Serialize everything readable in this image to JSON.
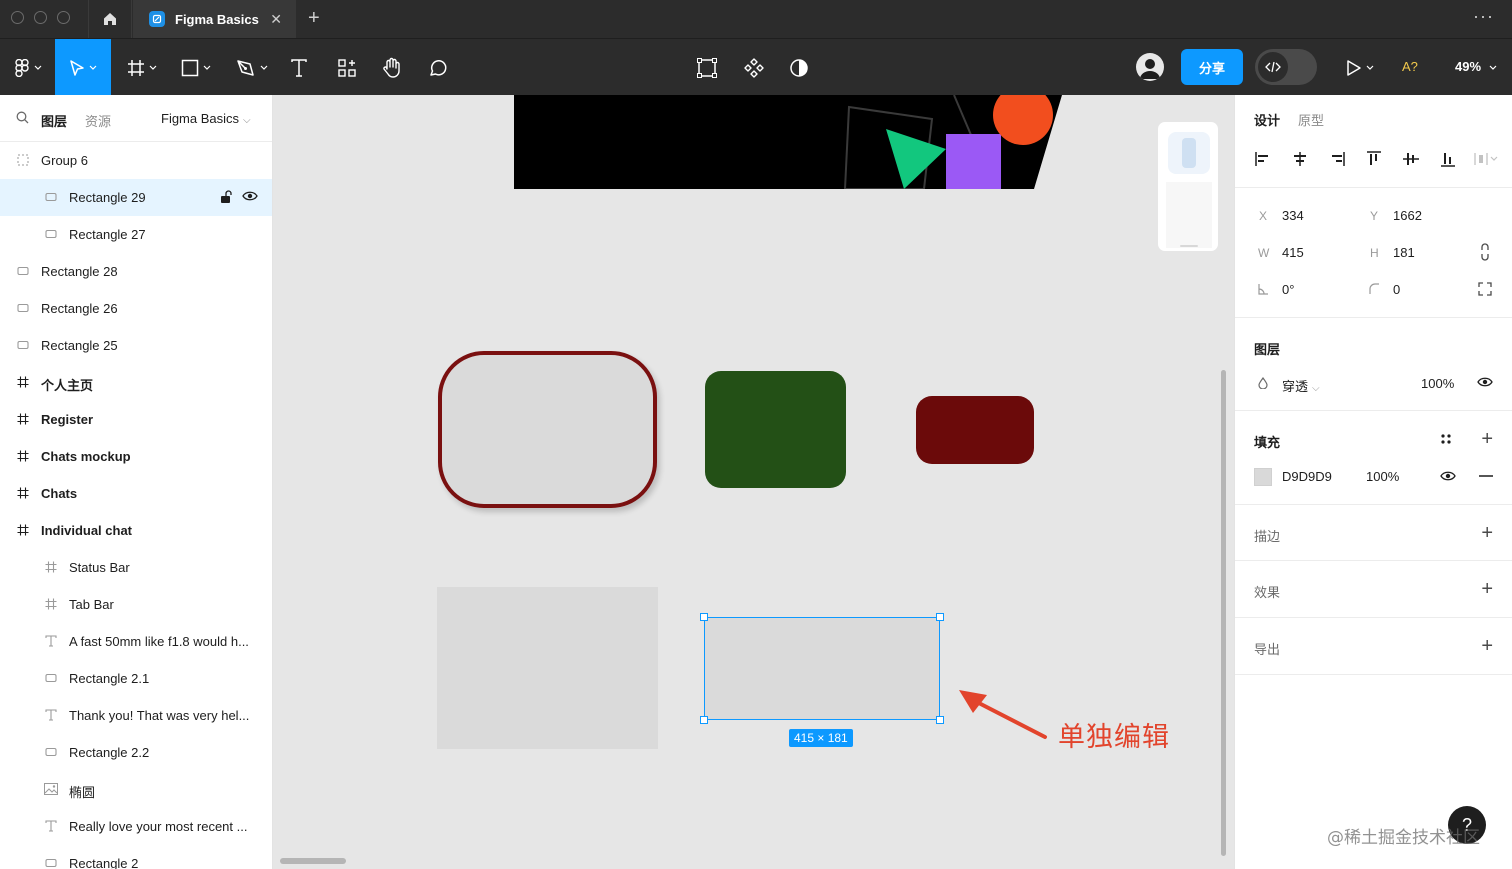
{
  "titlebar": {
    "file_tab": "Figma Basics",
    "new_tab_glyph": "+",
    "more_glyph": "···",
    "close_glyph": "✕"
  },
  "toolbar": {
    "share_label": "分享",
    "font_warning": "A?",
    "zoom_label": "49%",
    "tools": [
      "figma-menu-icon",
      "move-tool-icon",
      "frame-tool-icon",
      "rectangle-tool-icon",
      "pen-tool-icon",
      "text-tool-icon",
      "resources-icon",
      "hand-tool-icon",
      "comment-icon",
      "edit-object-icon",
      "component-icon",
      "mask-icon",
      "play-icon"
    ]
  },
  "left_panel": {
    "tab_layers": "图层",
    "tab_assets": "资源",
    "page_name": "Figma Basics",
    "layers": [
      {
        "label": "Group 6",
        "icon": "group-icon",
        "indent": 0,
        "bold": false,
        "selected": false
      },
      {
        "label": "Rectangle 29",
        "icon": "rectangle-icon",
        "indent": 1,
        "bold": false,
        "selected": true
      },
      {
        "label": "Rectangle 27",
        "icon": "rectangle-icon",
        "indent": 1,
        "bold": false,
        "selected": false
      },
      {
        "label": "Rectangle 28",
        "icon": "rectangle-icon",
        "indent": 0,
        "bold": false,
        "selected": false
      },
      {
        "label": "Rectangle 26",
        "icon": "rectangle-icon",
        "indent": 0,
        "bold": false,
        "selected": false
      },
      {
        "label": "Rectangle 25",
        "icon": "rectangle-icon",
        "indent": 0,
        "bold": false,
        "selected": false
      },
      {
        "label": "个人主页",
        "icon": "frame-icon",
        "indent": 0,
        "bold": true,
        "selected": false
      },
      {
        "label": "Register",
        "icon": "frame-icon",
        "indent": 0,
        "bold": true,
        "selected": false
      },
      {
        "label": "Chats mockup",
        "icon": "frame-icon",
        "indent": 0,
        "bold": true,
        "selected": false
      },
      {
        "label": "Chats",
        "icon": "frame-icon",
        "indent": 0,
        "bold": true,
        "selected": false
      },
      {
        "label": "Individual chat",
        "icon": "frame-icon",
        "indent": 0,
        "bold": true,
        "selected": false
      },
      {
        "label": "Status Bar",
        "icon": "frame-icon",
        "indent": 1,
        "bold": false,
        "selected": false
      },
      {
        "label": "Tab Bar",
        "icon": "frame-icon",
        "indent": 1,
        "bold": false,
        "selected": false
      },
      {
        "label": "A fast 50mm like f1.8 would h...",
        "icon": "text-icon",
        "indent": 1,
        "bold": false,
        "selected": false
      },
      {
        "label": "Rectangle 2.1",
        "icon": "rectangle-icon",
        "indent": 1,
        "bold": false,
        "selected": false
      },
      {
        "label": "Thank you! That was very hel...",
        "icon": "text-icon",
        "indent": 1,
        "bold": false,
        "selected": false
      },
      {
        "label": "Rectangle 2.2",
        "icon": "rectangle-icon",
        "indent": 1,
        "bold": false,
        "selected": false
      },
      {
        "label": "椭圆",
        "icon": "image-icon",
        "indent": 1,
        "bold": false,
        "selected": false
      },
      {
        "label": "Really love your most recent ...",
        "icon": "text-icon",
        "indent": 1,
        "bold": false,
        "selected": false
      },
      {
        "label": "Rectangle 2",
        "icon": "rectangle-icon",
        "indent": 1,
        "bold": false,
        "selected": false
      }
    ]
  },
  "canvas": {
    "selection_size": "415 × 181",
    "annotation": "单独编辑",
    "help_glyph": "?",
    "watermark": "@稀土掘金技术社区",
    "colors": {
      "outlined_border": "#7a1010",
      "green": "#235016",
      "dark_red": "#6b0a0a",
      "selection": "#0d99ff",
      "annotation": "#e2442c"
    }
  },
  "right_panel": {
    "tab_design": "设计",
    "tab_prototype": "原型",
    "x_label": "X",
    "x_value": "334",
    "y_label": "Y",
    "y_value": "1662",
    "w_label": "W",
    "w_value": "415",
    "h_label": "H",
    "h_value": "181",
    "rotation_value": "0°",
    "radius_value": "0",
    "layer_title": "图层",
    "blend_mode": "穿透",
    "layer_opacity": "100%",
    "fill_title": "填充",
    "fill_hex": "D9D9D9",
    "fill_opacity": "100%",
    "fill_swatch": "#d9d9d9",
    "stroke_title": "描边",
    "effects_title": "效果",
    "export_title": "导出"
  }
}
